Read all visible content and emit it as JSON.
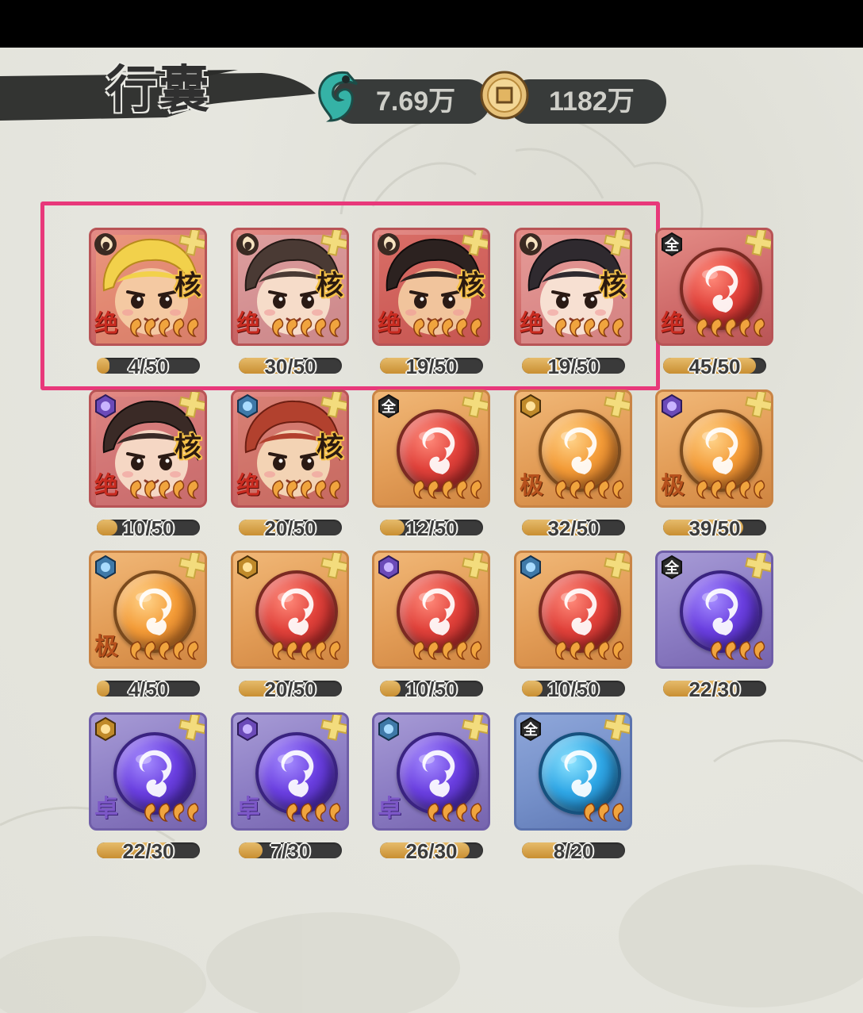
{
  "header": {
    "title": "行囊",
    "currency_jade": {
      "icon": "jade-icon",
      "value": "7.69万"
    },
    "currency_coin": {
      "icon": "coin-icon",
      "value": "1182万"
    }
  },
  "colors": {
    "highlight": "#e8387a",
    "bar_fill": "#c98f32",
    "bar_track": "#3a3a3a"
  },
  "items": [
    {
      "kind": "portrait",
      "theme": "red",
      "hero": "blonde-warrior",
      "core": "核",
      "grade": "绝",
      "pips": 5,
      "faction": "flame-spiral-icon",
      "progress": "4/50",
      "fill": 0.08,
      "highlighted": true
    },
    {
      "kind": "portrait",
      "theme": "red",
      "hero": "scholar",
      "core": "核",
      "grade": "绝",
      "pips": 5,
      "faction": "flame-spiral-icon",
      "progress": "30/50",
      "fill": 0.6,
      "highlighted": true
    },
    {
      "kind": "portrait",
      "theme": "red",
      "hero": "fire-warrior",
      "core": "核",
      "grade": "绝",
      "pips": 5,
      "faction": "flame-spiral-icon",
      "progress": "19/50",
      "fill": 0.38,
      "highlighted": true
    },
    {
      "kind": "portrait",
      "theme": "red",
      "hero": "lady",
      "core": "核",
      "grade": "绝",
      "pips": 5,
      "faction": "flame-spiral-icon",
      "progress": "19/50",
      "fill": 0.38,
      "highlighted": true
    },
    {
      "kind": "orb",
      "theme": "red",
      "orb": "red",
      "badge": "全",
      "grade": "绝",
      "pips": 5,
      "progress": "45/50",
      "fill": 0.9
    },
    {
      "kind": "portrait",
      "theme": "red",
      "hero": "masked-lady",
      "core": "核",
      "grade": "绝",
      "pips": 5,
      "faction": "purple-icon",
      "progress": "10/50",
      "fill": 0.2
    },
    {
      "kind": "portrait",
      "theme": "red",
      "hero": "monk",
      "core": "核",
      "grade": "绝",
      "pips": 5,
      "faction": "blue-icon",
      "progress": "20/50",
      "fill": 0.4
    },
    {
      "kind": "orb",
      "theme": "orange",
      "orb": "red",
      "badge": "全",
      "grade": "",
      "pips": 5,
      "progress": "12/50",
      "fill": 0.24
    },
    {
      "kind": "orb",
      "theme": "orange",
      "orb": "orange",
      "faction": "gold-icon",
      "grade": "极",
      "pips": 5,
      "progress": "32/50",
      "fill": 0.64
    },
    {
      "kind": "orb",
      "theme": "orange",
      "orb": "orange",
      "faction": "purple-icon",
      "grade": "极",
      "pips": 5,
      "progress": "39/50",
      "fill": 0.78
    },
    {
      "kind": "orb",
      "theme": "orange",
      "orb": "orange",
      "faction": "blue-icon",
      "grade": "极",
      "pips": 5,
      "progress": "4/50",
      "fill": 0.08
    },
    {
      "kind": "orb",
      "theme": "orange",
      "orb": "red",
      "faction": "gold-icon",
      "grade": "",
      "pips": 5,
      "progress": "20/50",
      "fill": 0.4
    },
    {
      "kind": "orb",
      "theme": "orange",
      "orb": "red",
      "faction": "purple-icon",
      "grade": "",
      "pips": 5,
      "progress": "10/50",
      "fill": 0.2
    },
    {
      "kind": "orb",
      "theme": "orange",
      "orb": "red",
      "faction": "blue-icon",
      "grade": "",
      "pips": 5,
      "progress": "10/50",
      "fill": 0.2
    },
    {
      "kind": "orb",
      "theme": "purple",
      "orb": "purple",
      "badge": "全",
      "grade": "",
      "pips": 4,
      "progress": "22/30",
      "fill": 0.73
    },
    {
      "kind": "orb",
      "theme": "purple",
      "orb": "purple",
      "faction": "gold-icon",
      "grade": "卓",
      "pips": 4,
      "progress": "22/30",
      "fill": 0.73
    },
    {
      "kind": "orb",
      "theme": "purple",
      "orb": "purple",
      "faction": "purple-icon",
      "grade": "卓",
      "pips": 4,
      "progress": "7/30",
      "fill": 0.23
    },
    {
      "kind": "orb",
      "theme": "purple",
      "orb": "purple",
      "faction": "blue-icon",
      "grade": "卓",
      "pips": 4,
      "progress": "26/30",
      "fill": 0.87
    },
    {
      "kind": "orb",
      "theme": "blue",
      "orb": "blue",
      "badge": "全",
      "grade": "",
      "pips": 3,
      "progress": "8/20",
      "fill": 0.4
    }
  ]
}
